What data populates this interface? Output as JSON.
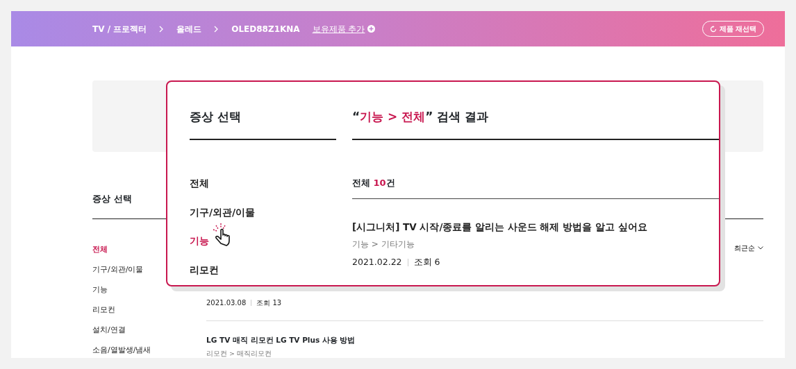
{
  "breadcrumb": {
    "items": [
      "TV / 프로젝터",
      "올레드",
      "OLED88Z1KNA"
    ],
    "add_link": "보유제품 추가",
    "reselect_button": "제품 재선택"
  },
  "sidebar": {
    "title": "증상 선택",
    "items": [
      {
        "label": "전체",
        "selected": true
      },
      {
        "label": "기구/외관/이물",
        "selected": false
      },
      {
        "label": "기능",
        "selected": false
      },
      {
        "label": "리모컨",
        "selected": false
      },
      {
        "label": "설치/연결",
        "selected": false
      },
      {
        "label": "소음/열발생/냄새",
        "selected": false
      }
    ]
  },
  "sort": {
    "label": "최근순"
  },
  "articles": [
    {
      "date": "2021.03.08",
      "views": "조회 13"
    },
    {
      "title": "LG TV 매직 리모컨 LG TV Plus 사용 방법",
      "category": "리모컨 > 매직리모컨"
    }
  ],
  "popup": {
    "title": "증상 선택",
    "items": [
      {
        "label": "전체",
        "selected": false
      },
      {
        "label": "기구/외관/이물",
        "selected": false
      },
      {
        "label": "기능",
        "selected": true
      },
      {
        "label": "리모컨",
        "selected": false
      }
    ],
    "result_heading": {
      "open_quote": "“",
      "query": "기능 > 전체",
      "close": "” 검색 결과"
    },
    "count": {
      "label": "전체",
      "number": "10",
      "unit": "건"
    },
    "results": [
      {
        "title": "[시그니처] TV 시작/종료를 알리는 사운드 해제 방법을 알고 싶어요",
        "category": "기능 > 기타기능",
        "date": "2021.02.22",
        "views": "조회 6"
      }
    ]
  }
}
